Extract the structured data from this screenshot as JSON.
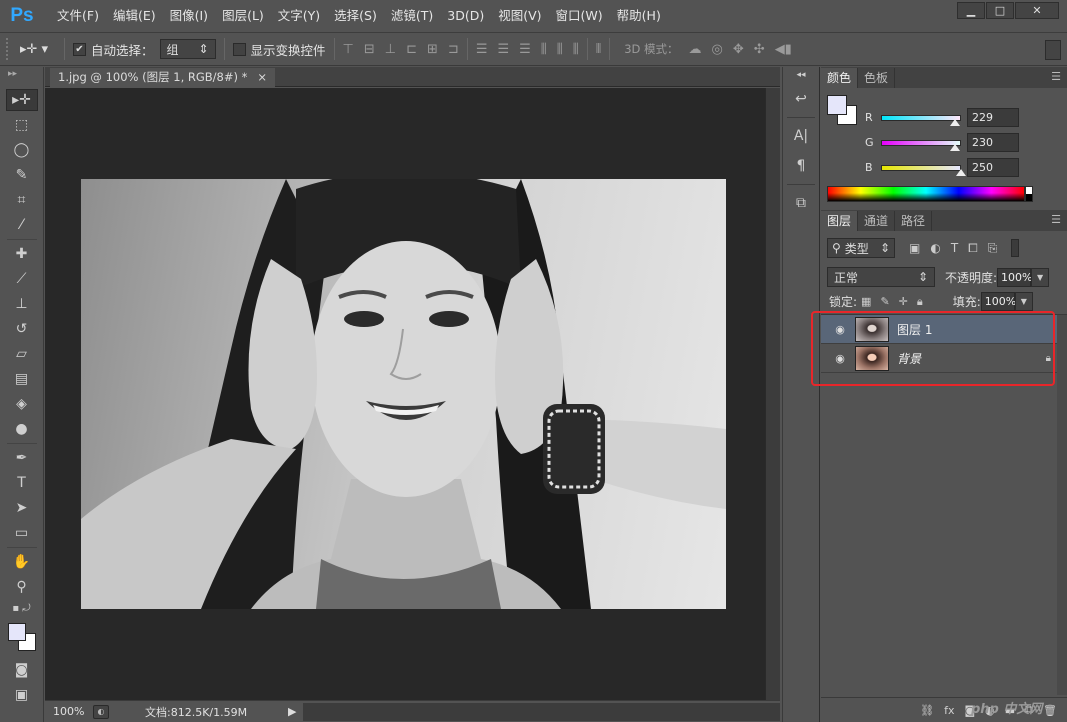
{
  "app": {
    "logo": "Ps"
  },
  "menubar": {
    "items": [
      "文件(F)",
      "编辑(E)",
      "图像(I)",
      "图层(L)",
      "文字(Y)",
      "选择(S)",
      "滤镜(T)",
      "3D(D)",
      "视图(V)",
      "窗口(W)",
      "帮助(H)"
    ]
  },
  "window_controls": {
    "minimize": "▁",
    "restore": "□",
    "close": "✕"
  },
  "options_bar": {
    "auto_select_label": "自动选择：",
    "auto_select_checked": true,
    "auto_select_value": "组",
    "show_transform_label": "显示变换控件",
    "mode_3d_label": "3D 模式："
  },
  "document": {
    "tab_title": "1.jpg @ 100% (图层 1, RGB/8#) *",
    "tab_close": "×",
    "zoom": "100%",
    "doc_info": "文档:812.5K/1.59M"
  },
  "color_panel": {
    "tabs": [
      "颜色",
      "色板"
    ],
    "fg_color": "#e5e6fa",
    "bg_color": "#ffffff",
    "r_label": "R",
    "r_value": "229",
    "g_label": "G",
    "g_value": "230",
    "b_label": "B",
    "b_value": "250"
  },
  "layers_panel": {
    "tabs": [
      "图层",
      "通道",
      "路径"
    ],
    "filter_label": "类型",
    "blend_mode": "正常",
    "opacity_label": "不透明度:",
    "opacity_value": "100%",
    "lock_label": "锁定:",
    "fill_label": "填充:",
    "fill_value": "100%",
    "layers": [
      {
        "name": "图层 1",
        "selected": true,
        "visible": true
      },
      {
        "name": "背景",
        "selected": false,
        "visible": true,
        "locked": true
      }
    ]
  },
  "watermark": "php 中文网"
}
